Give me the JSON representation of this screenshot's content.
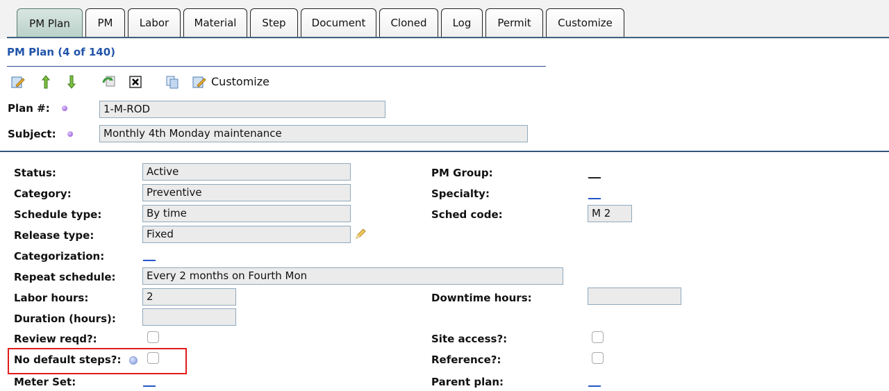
{
  "tabs": [
    "PM Plan",
    "PM",
    "Labor",
    "Material",
    "Step",
    "Document",
    "Cloned",
    "Log",
    "Permit",
    "Customize"
  ],
  "page_title": "PM Plan (4 of 140)",
  "toolbar": {
    "icons": [
      "edit-icon",
      "move-up-icon",
      "move-down-icon",
      "refresh-icon",
      "close-box-icon",
      "copy-icon",
      "customize-icon"
    ],
    "customize_label": "Customize"
  },
  "header_fields": {
    "plan_label": "Plan #:",
    "plan_value": "1-M-ROD",
    "subject_label": "Subject:",
    "subject_value": "Monthly 4th Monday maintenance"
  },
  "left_fields": {
    "status": {
      "label": "Status:",
      "value": "Active"
    },
    "category": {
      "label": "Category:",
      "value": "Preventive"
    },
    "schedule_type": {
      "label": "Schedule type:",
      "value": "By time"
    },
    "release_type": {
      "label": "Release type:",
      "value": "Fixed"
    },
    "categorization": {
      "label": "Categorization:"
    },
    "repeat_schedule": {
      "label": "Repeat schedule:",
      "value": "Every 2 months on Fourth Mon"
    },
    "labor_hours": {
      "label": "Labor hours:",
      "value": "2"
    },
    "duration_hours": {
      "label": "Duration (hours):",
      "value": ""
    },
    "review_reqd": {
      "label": "Review reqd?:"
    },
    "no_default_steps": {
      "label": "No default steps?:"
    },
    "meter_set": {
      "label": "Meter Set:"
    }
  },
  "right_fields": {
    "pm_group": {
      "label": "PM Group:"
    },
    "specialty": {
      "label": "Specialty:"
    },
    "sched_code": {
      "label": "Sched code:",
      "value": "M 2"
    },
    "downtime_hours": {
      "label": "Downtime hours:",
      "value": ""
    },
    "site_access": {
      "label": "Site access?:"
    },
    "reference": {
      "label": "Reference?:"
    },
    "parent_plan": {
      "label": "Parent plan:"
    }
  },
  "colors": {
    "accent": "#2255aa",
    "highlight": "#e01b1b",
    "tab_active": "#c6dcd4",
    "field_bg": "#ebebeb"
  }
}
